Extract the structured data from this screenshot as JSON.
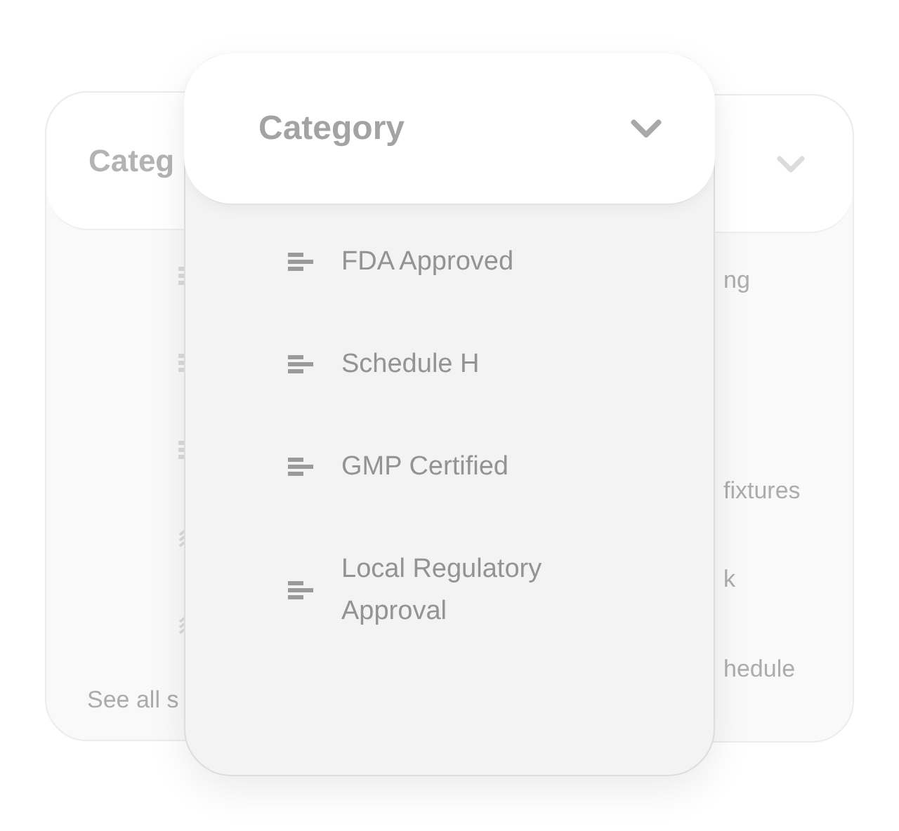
{
  "back_left": {
    "title": "Categ",
    "items": [
      {
        "kind": "bars"
      },
      {
        "kind": "bars"
      },
      {
        "kind": "bars"
      },
      {
        "kind": "slash"
      },
      {
        "kind": "slash"
      }
    ],
    "footer": "See all s"
  },
  "back_right": {
    "items": [
      "ng",
      "fixtures",
      "k",
      "hedule"
    ]
  },
  "dropdown": {
    "title": "Category",
    "expanded": true,
    "options": [
      "FDA Approved",
      "Schedule H",
      "GMP Certified",
      "Local Regulatory Approval"
    ]
  }
}
